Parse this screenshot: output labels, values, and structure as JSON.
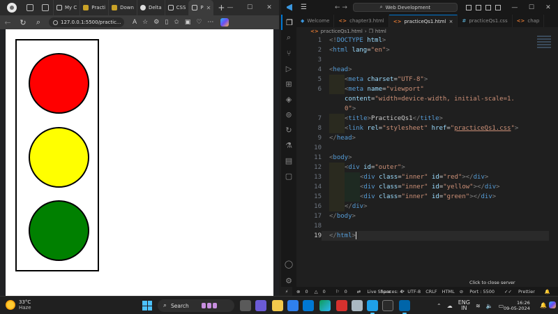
{
  "browser": {
    "tabs": [
      {
        "title": "My C",
        "icon": "page-icon"
      },
      {
        "title": "Practi",
        "icon": "amazon-icon"
      },
      {
        "title": "Down",
        "icon": "amazon-icon"
      },
      {
        "title": "Delta",
        "icon": "github-icon"
      },
      {
        "title": "CSS",
        "icon": "page-icon"
      },
      {
        "title": "P",
        "icon": "page-icon",
        "active": true
      }
    ],
    "address": "127.0.0.1:5500/practic...",
    "page": {
      "lights": [
        {
          "id": "red",
          "color": "#ff0000"
        },
        {
          "id": "yellow",
          "color": "#ffff00"
        },
        {
          "id": "green",
          "color": "#008000"
        }
      ]
    }
  },
  "vscode": {
    "search": "Web Development",
    "tabs": [
      {
        "name": "Welcome",
        "icon": "vscode-icon"
      },
      {
        "name": "chapter3.html",
        "icon": "html-icon"
      },
      {
        "name": "practiceQs1.html",
        "icon": "html-icon",
        "active": true,
        "close": "×"
      },
      {
        "name": "practiceQs1.css",
        "icon": "css-icon"
      },
      {
        "name": "chap",
        "icon": "html-icon"
      }
    ],
    "breadcrumb": [
      "practiceQs1.html",
      "html"
    ],
    "lines": [
      {
        "n": "1"
      },
      {
        "n": "2"
      },
      {
        "n": "3"
      },
      {
        "n": "4"
      },
      {
        "n": "5"
      },
      {
        "n": "6"
      },
      {
        "n": ""
      },
      {
        "n": ""
      },
      {
        "n": "7"
      },
      {
        "n": "8"
      },
      {
        "n": "9"
      },
      {
        "n": "10"
      },
      {
        "n": "11"
      },
      {
        "n": "12"
      },
      {
        "n": "13"
      },
      {
        "n": "14"
      },
      {
        "n": "15"
      },
      {
        "n": "16"
      },
      {
        "n": "17"
      },
      {
        "n": "18"
      },
      {
        "n": "19"
      }
    ],
    "tooltip": "Click to close server",
    "status": {
      "errors": "0",
      "warnings": "0",
      "info": "0",
      "live_share": "Live Share",
      "spaces": "Spaces: 4",
      "encoding": "UTF-8",
      "eol": "CRLF",
      "language": "HTML",
      "port": "Port : 5500",
      "prettier": "Prettier"
    }
  },
  "taskbar": {
    "weather_temp": "33°C",
    "weather_cond": "Haze",
    "search_label": "Search",
    "lang_top": "ENG",
    "lang_bottom": "IN",
    "time": "16:26",
    "date": "09-05-2024"
  }
}
